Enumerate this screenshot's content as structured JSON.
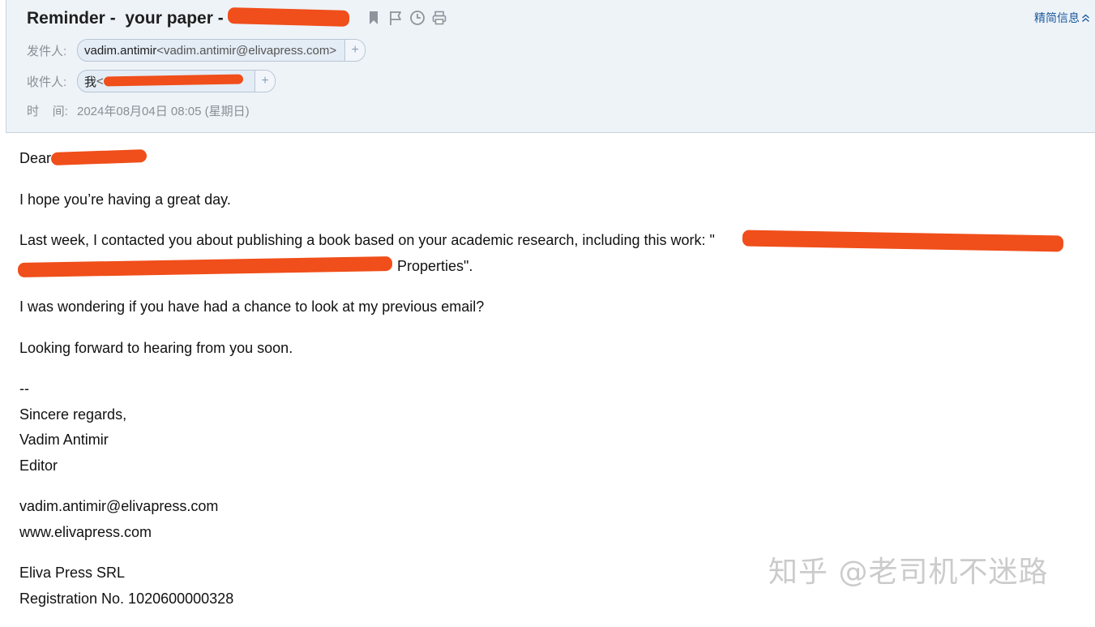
{
  "header": {
    "subject": "Reminder -  your paper - ",
    "toggle_label": "精简信息",
    "tools": [
      "bookmark-icon",
      "flag-icon",
      "clock-icon",
      "print-icon"
    ],
    "from": {
      "label": "发件人:",
      "name": "vadim.antimir",
      "address": "<vadim.antimir@elivapress.com>"
    },
    "to": {
      "label": "收件人:",
      "name": "我",
      "address": "<"
    },
    "time": {
      "label": "时    间:",
      "value": "2024年08月04日 08:05 (星期日)"
    }
  },
  "body": {
    "greeting": "Dear ",
    "p1": "I hope you’re having a great day.",
    "p2_line1": "Last week, I contacted you about publishing a book based on your academic research, including this work: \"",
    "p2_line2": "Properties\".",
    "p3": "I was wondering if you have had a chance to look at my previous email?",
    "p4": "Looking forward to hearing from you soon.",
    "sig_dash": "--",
    "sig_regards": "Sincere regards,",
    "sig_name": "Vadim Antimir",
    "sig_title": "Editor",
    "sig_email": "vadim.antimir@elivapress.com",
    "sig_web": "www.elivapress.com",
    "company": "Eliva Press SRL",
    "registration": "Registration No. 1020600000328"
  },
  "watermark": "知乎 @老司机不迷路",
  "colors": {
    "header_bg": "#eef3f8",
    "link": "#1a5a9c",
    "redaction": "#f04e1a"
  }
}
